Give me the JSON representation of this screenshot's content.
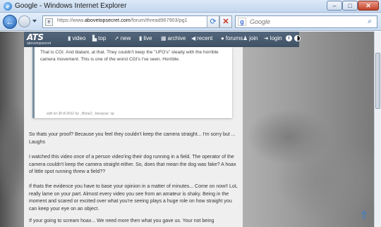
{
  "window": {
    "title": "Google - Windows Internet Explorer",
    "min_label": "–",
    "max_label": "□",
    "close_label": "✕"
  },
  "navbar": {
    "url_prefix": "https://www.",
    "url_domain": "abovetopsecret.com",
    "url_path": "/forum/thread967903/pg1",
    "search_placeholder": "Google",
    "refresh_glyph": "⟳",
    "stop_glyph": "✕",
    "back_glyph": "←",
    "search_go_glyph": "⌕"
  },
  "site": {
    "logo_big": "ATS",
    "logo_small": "abovetopsecret",
    "nav": [
      {
        "icon": "▮",
        "label": "video"
      },
      {
        "icon": "▙",
        "label": "top"
      },
      {
        "icon": "➚",
        "label": "new"
      },
      {
        "icon": "▮",
        "label": "live"
      },
      {
        "icon": "▦",
        "label": "archive"
      },
      {
        "icon": "◀",
        "label": "recent"
      },
      {
        "icon": "●",
        "label": "forums"
      },
      {
        "icon": "♟",
        "label": "join"
      },
      {
        "icon": "➜",
        "label": "login"
      }
    ],
    "info_glyph": "i"
  },
  "post": {
    "quote_text": "That is CGI. And blatant, at that. They couldn't keep the \"UFO's\" steady with the horrible camera movement. This is one of the worst CGI's I've seen. Horrible.",
    "quote_edit": "edit on 30-8-2012 by _Bone2_ because: sp",
    "paragraphs": [
      "So thats your proof? Because you feel they couldn't keep the camera straight... I'm sorry but ... Laughs",
      "I watched this video once of a person video'ing their dog running in a field. The operator of the camera couldn't keep the camera straight either. So, does that mean the dog was fake? A hoax of little spot running threw a field??",
      "If thats the evidence you have to base your opinion in a matter of minutes... Come on now!! LoL really lame on your part. Almost every video you see from an amateur is shaky. Being in the moment and scared or excited over what you're seeing plays a huge role on how straight you can keep your eye on an object.",
      "If your going to scream hoax... We need more then what you gave us. Your not being"
    ]
  },
  "scroll_top_glyph": "⇧"
}
